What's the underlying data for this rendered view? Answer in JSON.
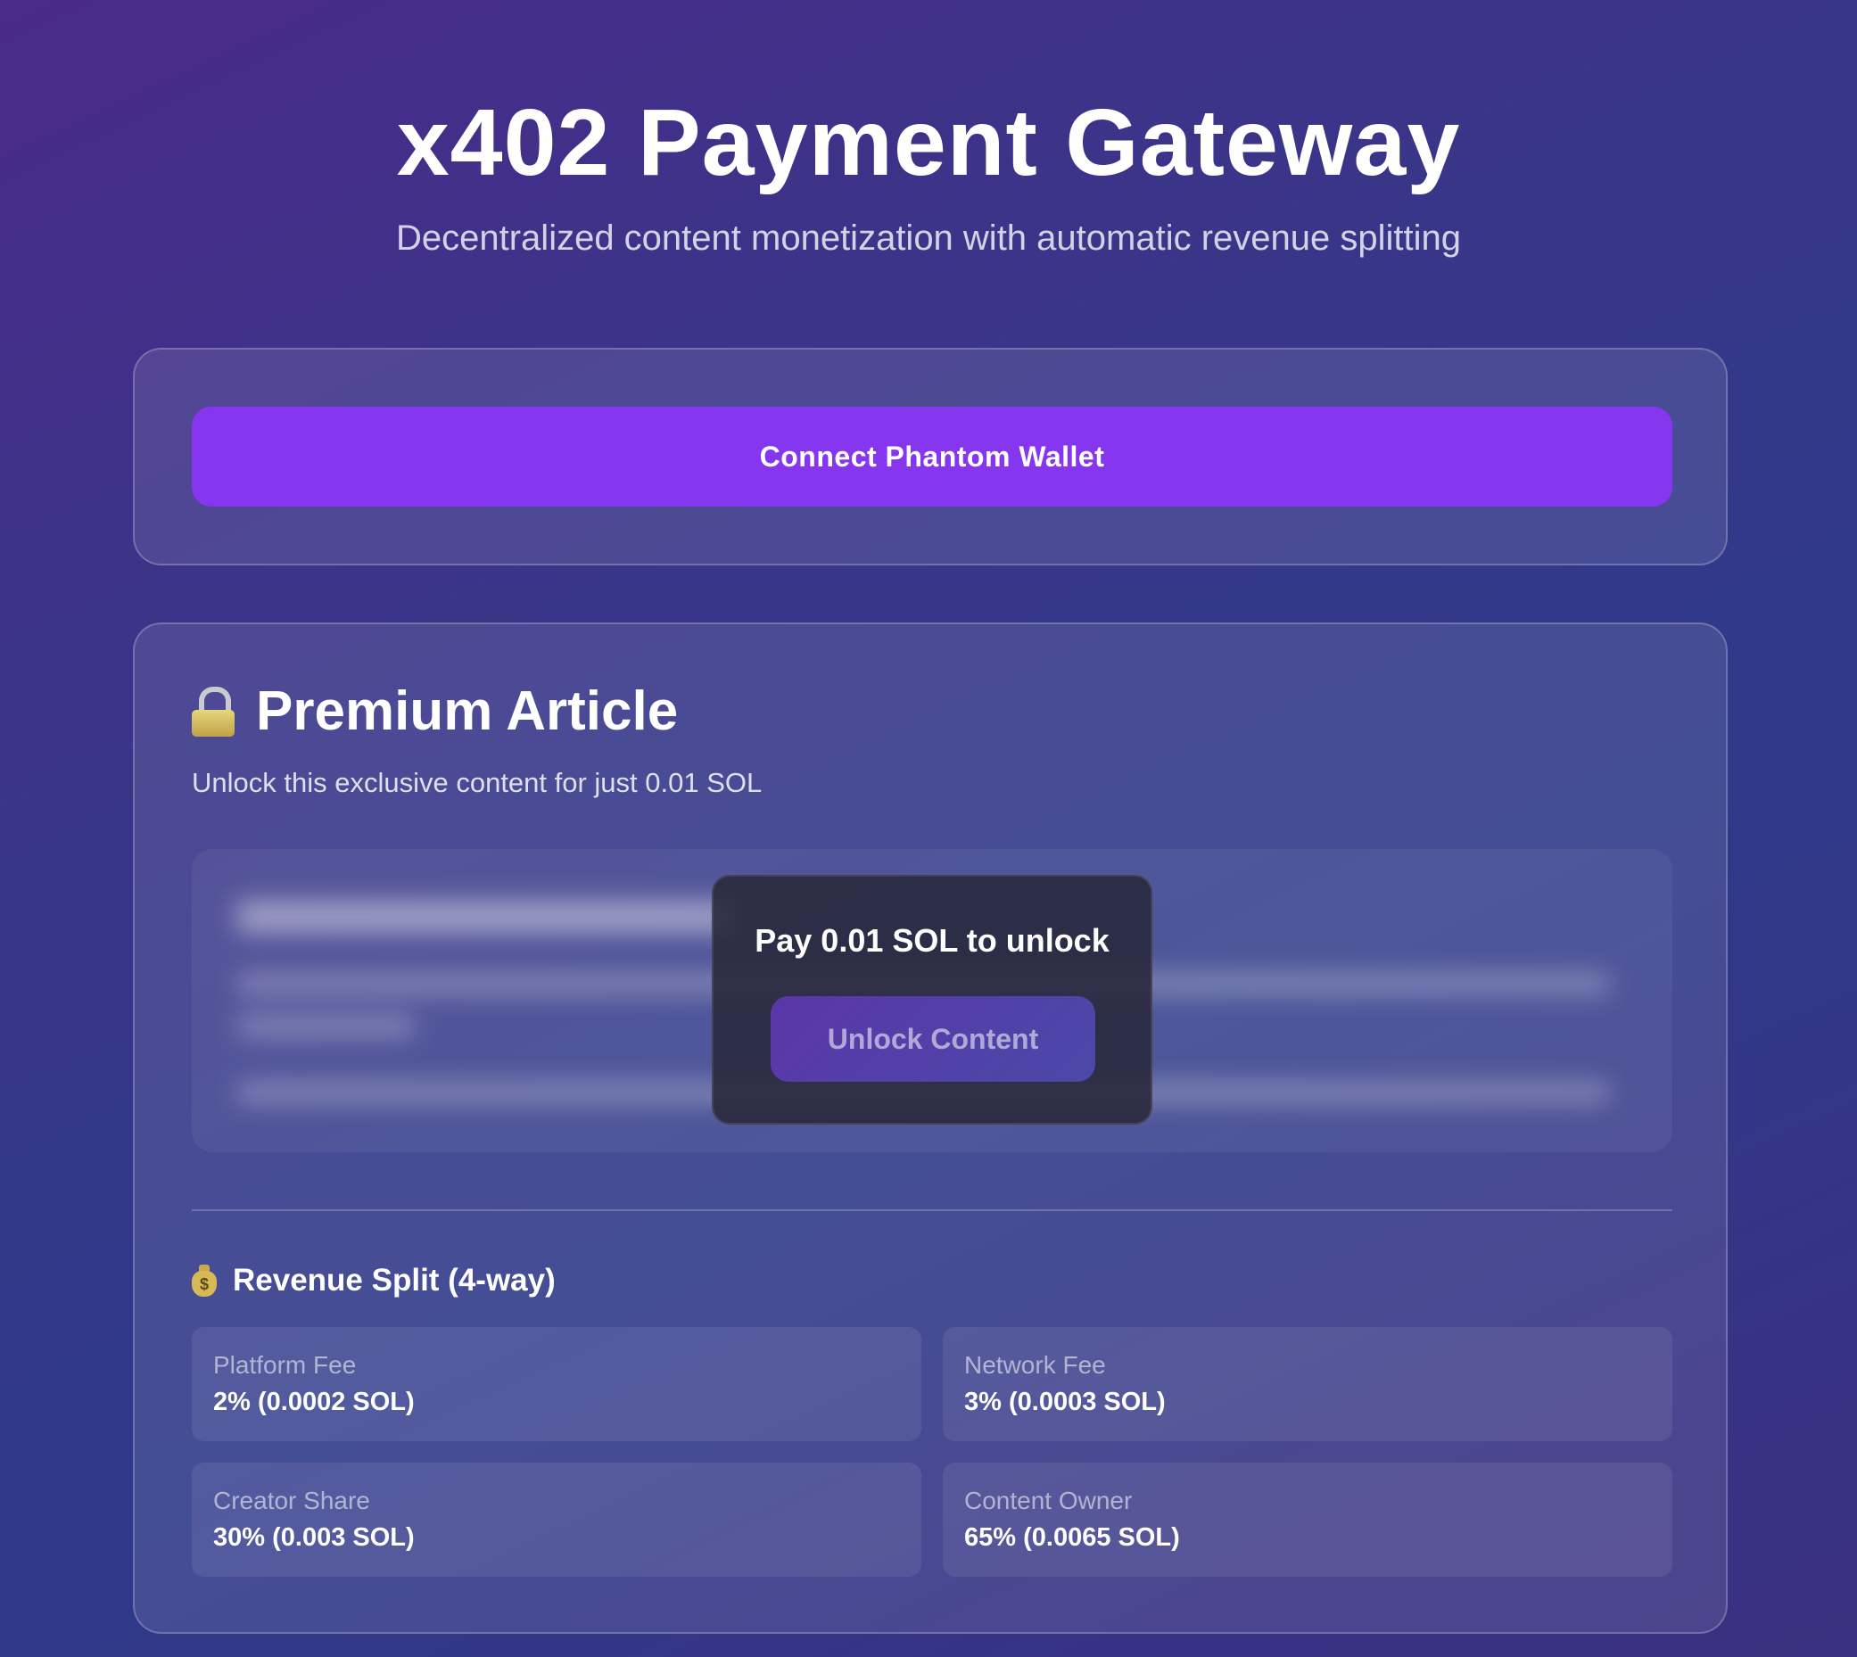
{
  "header": {
    "title": "x402 Payment Gateway",
    "subtitle": "Decentralized content monetization with automatic revenue splitting"
  },
  "wallet": {
    "connect_label": "Connect Phantom Wallet"
  },
  "article": {
    "icon": "lock-icon",
    "title": "Premium Article",
    "description": "Unlock this exclusive content for just 0.01 SOL",
    "paywall": {
      "prompt": "Pay 0.01 SOL to unlock",
      "unlock_label": "Unlock Content"
    }
  },
  "revenue_split": {
    "icon": "money-bag-icon",
    "heading": "Revenue Split (4-way)",
    "items": [
      {
        "label": "Platform Fee",
        "value": "2% (0.0002 SOL)"
      },
      {
        "label": "Network Fee",
        "value": "3% (0.0003 SOL)"
      },
      {
        "label": "Creator Share",
        "value": "30% (0.003 SOL)"
      },
      {
        "label": "Content Owner",
        "value": "65% (0.0065 SOL)"
      }
    ]
  },
  "colors": {
    "accent": "#8536ee",
    "background_start": "#4a2a8a",
    "background_end": "#2f3a8a"
  }
}
